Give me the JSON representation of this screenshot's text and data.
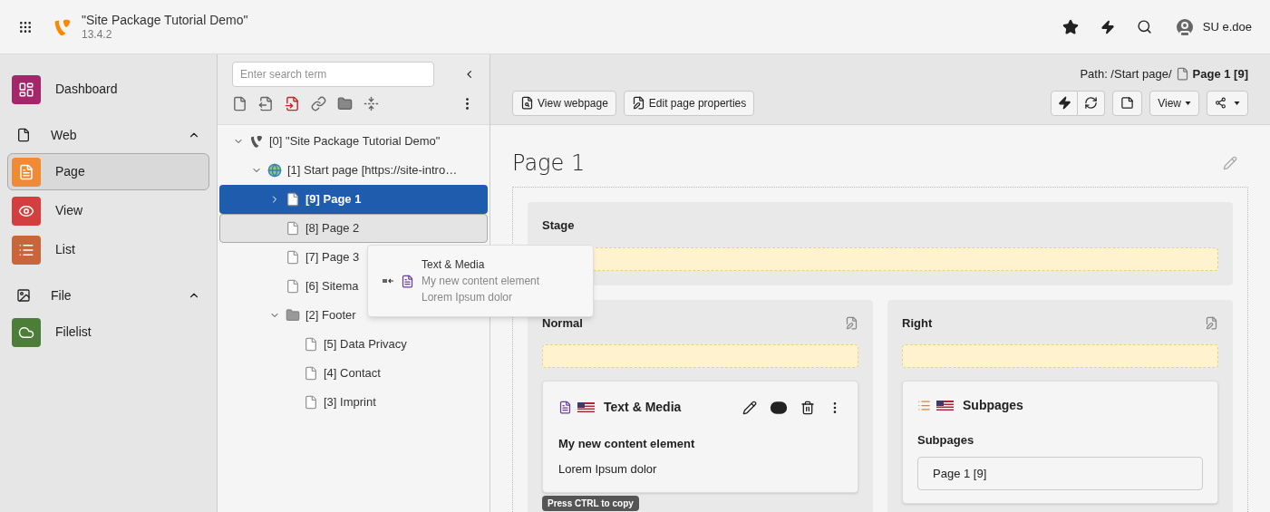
{
  "topbar": {
    "site_title": "\"Site Package Tutorial Demo\"",
    "version": "13.4.2",
    "user": "SU e.doe"
  },
  "modules": [
    {
      "kind": "dashboard",
      "label": "Dashboard",
      "color": "#a4276a",
      "selected": false
    },
    {
      "kind": "web_group",
      "label": "Web",
      "expanded": true,
      "children": [
        {
          "kind": "page",
          "label": "Page",
          "color": "#f08a35",
          "selected": true
        },
        {
          "kind": "view",
          "label": "View",
          "color": "#d33f3f",
          "selected": false
        },
        {
          "kind": "list",
          "label": "List",
          "color": "#c9653a",
          "selected": false
        }
      ]
    },
    {
      "kind": "file_group",
      "label": "File",
      "expanded": true,
      "children": [
        {
          "kind": "filelist",
          "label": "Filelist",
          "color": "#4c7e3a",
          "selected": false
        }
      ]
    }
  ],
  "tree": {
    "search": {
      "placeholder": "Enter search term"
    },
    "nodes": [
      {
        "kind": "root",
        "label": "[0] \"Site Package Tutorial Demo\"",
        "selected": false,
        "hovered": false,
        "expanded": true,
        "children": [
          {
            "kind": "globe",
            "label": "[1] Start page [https://site-intro…",
            "selected": false,
            "hovered": false,
            "expanded": true,
            "children": [
              {
                "kind": "page",
                "label": "[9] Page 1",
                "selected": true,
                "hovered": false,
                "expanded": false
              },
              {
                "kind": "page",
                "label": "[8] Page 2",
                "selected": false,
                "hovered": true
              },
              {
                "kind": "page",
                "label": "[7] Page 3",
                "selected": false,
                "hovered": false
              },
              {
                "kind": "page",
                "label": "[6] Sitema",
                "selected": false,
                "hovered": false
              },
              {
                "kind": "folder",
                "label": "[2] Footer",
                "selected": false,
                "hovered": false,
                "expanded": true,
                "children": [
                  {
                    "kind": "page",
                    "label": "[5] Data Privacy",
                    "selected": false,
                    "hovered": false
                  },
                  {
                    "kind": "page",
                    "label": "[4] Contact",
                    "selected": false,
                    "hovered": false
                  },
                  {
                    "kind": "page",
                    "label": "[3] Imprint",
                    "selected": false,
                    "hovered": false
                  }
                ]
              }
            ]
          }
        ]
      }
    ]
  },
  "drag_preview": {
    "type": "Text & Media",
    "header": "My new content element",
    "body": "Lorem Ipsum dolor"
  },
  "docheader": {
    "path_label": "Path: /Start page/",
    "path_page": "Page 1 [9]",
    "view_webpage": "View webpage",
    "edit_properties": "Edit page properties",
    "view_menu": "View"
  },
  "page": {
    "title": "Page 1",
    "stage": {
      "title": "Stage"
    },
    "columns": [
      {
        "title": "Normal",
        "elements": [
          {
            "kind": "textmedia",
            "type": "Text & Media",
            "header": "My new content element",
            "body": "Lorem Ipsum dolor"
          }
        ]
      },
      {
        "title": "Right",
        "elements": [
          {
            "kind": "menu",
            "type": "Subpages",
            "header": "Subpages",
            "items": [
              "Page 1 [9]"
            ]
          }
        ]
      }
    ],
    "copy_hint": "Press CTRL to copy"
  }
}
